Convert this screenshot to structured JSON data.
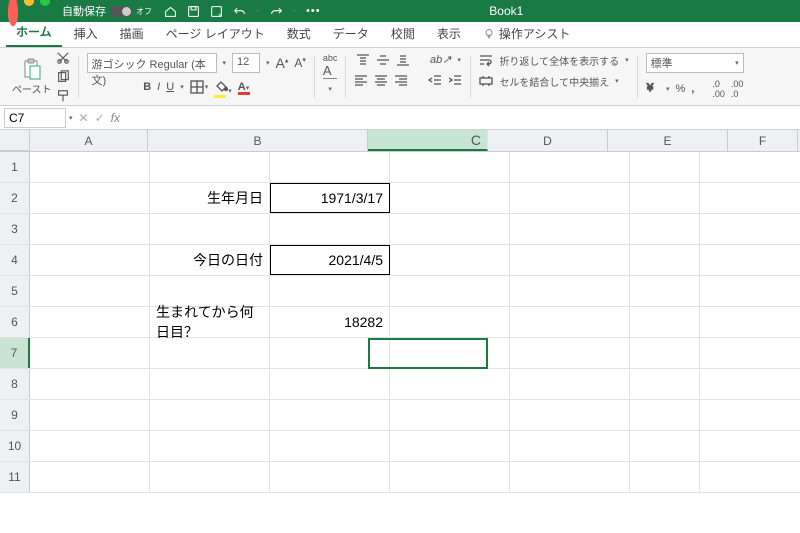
{
  "titlebar": {
    "autosave_label": "自動保存",
    "autosave_state": "オフ",
    "book_title": "Book1"
  },
  "tabs": {
    "home": "ホーム",
    "insert": "挿入",
    "draw": "描画",
    "pagelayout": "ページ レイアウト",
    "formulas": "数式",
    "data": "データ",
    "review": "校閲",
    "view": "表示",
    "assist": "操作アシスト"
  },
  "ribbon": {
    "paste": "ペースト",
    "font_name": "游ゴシック Regular (本文)",
    "font_size": "12",
    "wrap": "折り返して全体を表示する",
    "merge": "セルを結合して中央揃え",
    "number_format": "標準",
    "abc": "abc"
  },
  "fxbar": {
    "cell_ref": "C7"
  },
  "columns": [
    "A",
    "B",
    "C",
    "D",
    "E",
    "F"
  ],
  "cells": {
    "B2": "生年月日",
    "C2": "1971/3/17",
    "B4": "今日の日付",
    "C4": "2021/4/5",
    "B6": "生まれてから何日目？",
    "C6": "18282"
  },
  "selected_cell": "C7",
  "row_count": 11
}
